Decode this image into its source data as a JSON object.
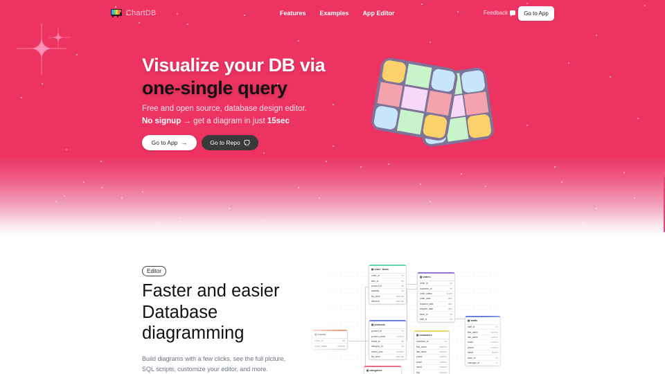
{
  "nav": {
    "brand": "ChartDB",
    "links": [
      "Features",
      "Examples",
      "App Editor"
    ],
    "feedback": "Feedback",
    "cta": "Go to App"
  },
  "hero": {
    "headline_line1": "Visualize your DB via",
    "headline_line2": "one-single query",
    "subtitle": "Free and open source, database design editor.",
    "tagline_bold1": "No signup",
    "tagline_mid": " → get a diagram in just ",
    "tagline_bold2": "15sec",
    "btn_app": "Go to App",
    "btn_repo": "Go to Repo",
    "colors": {
      "accent": "#ec3362",
      "dark_button": "#3a3a3a"
    }
  },
  "editor": {
    "badge": "Editor",
    "title_lines": [
      "Faster and easier",
      "Database",
      "diagramming"
    ],
    "desc_lines": [
      "Build diagrams with a few clicks, see the full picture,",
      "SQL scripts, customize your editor, and more."
    ]
  },
  "diagram": {
    "tables": [
      {
        "name": "order_items",
        "color": "#5fd3b0",
        "columns": [
          [
            "order_id",
            "int"
          ],
          [
            "item_id",
            "int"
          ],
          [
            "product_id",
            "int"
          ],
          [
            "quantity",
            "int"
          ],
          [
            "list_price",
            "decimal"
          ],
          [
            "discount",
            "decimal"
          ]
        ]
      },
      {
        "name": "orders",
        "color": "#a06ee6",
        "columns": [
          [
            "order_id",
            "int"
          ],
          [
            "customer_id",
            "int"
          ],
          [
            "order_status",
            "tinyint"
          ],
          [
            "order_date",
            "date"
          ],
          [
            "required_date",
            "date"
          ],
          [
            "shipped_date",
            "date"
          ],
          [
            "store_id",
            "int"
          ],
          [
            "staff_id",
            "int"
          ]
        ]
      },
      {
        "name": "products",
        "color": "#6b7fe0",
        "columns": [
          [
            "product_id",
            "int"
          ],
          [
            "product_name",
            "varchar"
          ],
          [
            "brand_id",
            "int"
          ],
          [
            "category_id",
            "int"
          ],
          [
            "model_year",
            "smallint"
          ],
          [
            "list_price",
            "decimal"
          ]
        ]
      },
      {
        "name": "brands",
        "color": "#f0a07a",
        "columns": [
          [
            "brand_id",
            "int"
          ],
          [
            "brand_name",
            "varchar"
          ]
        ]
      },
      {
        "name": "customers",
        "color": "#f5d66a",
        "columns": [
          [
            "customer_id",
            "int"
          ],
          [
            "first_name",
            "varchar"
          ],
          [
            "last_name",
            "varchar"
          ],
          [
            "phone",
            "varchar"
          ],
          [
            "email",
            "varchar"
          ],
          [
            "street",
            "varchar"
          ],
          [
            "city",
            "varchar"
          ]
        ]
      },
      {
        "name": "staffs",
        "color": "#6b7fe0",
        "columns": [
          [
            "staff_id",
            "int"
          ],
          [
            "first_name",
            "varchar"
          ],
          [
            "last_name",
            "varchar"
          ],
          [
            "email",
            "varchar"
          ],
          [
            "phone",
            "varchar"
          ],
          [
            "active",
            "tinyint"
          ],
          [
            "store_id",
            "int"
          ],
          [
            "manager_id",
            "int"
          ]
        ]
      },
      {
        "name": "categories",
        "color": "#ee6a7c",
        "columns": []
      }
    ]
  }
}
